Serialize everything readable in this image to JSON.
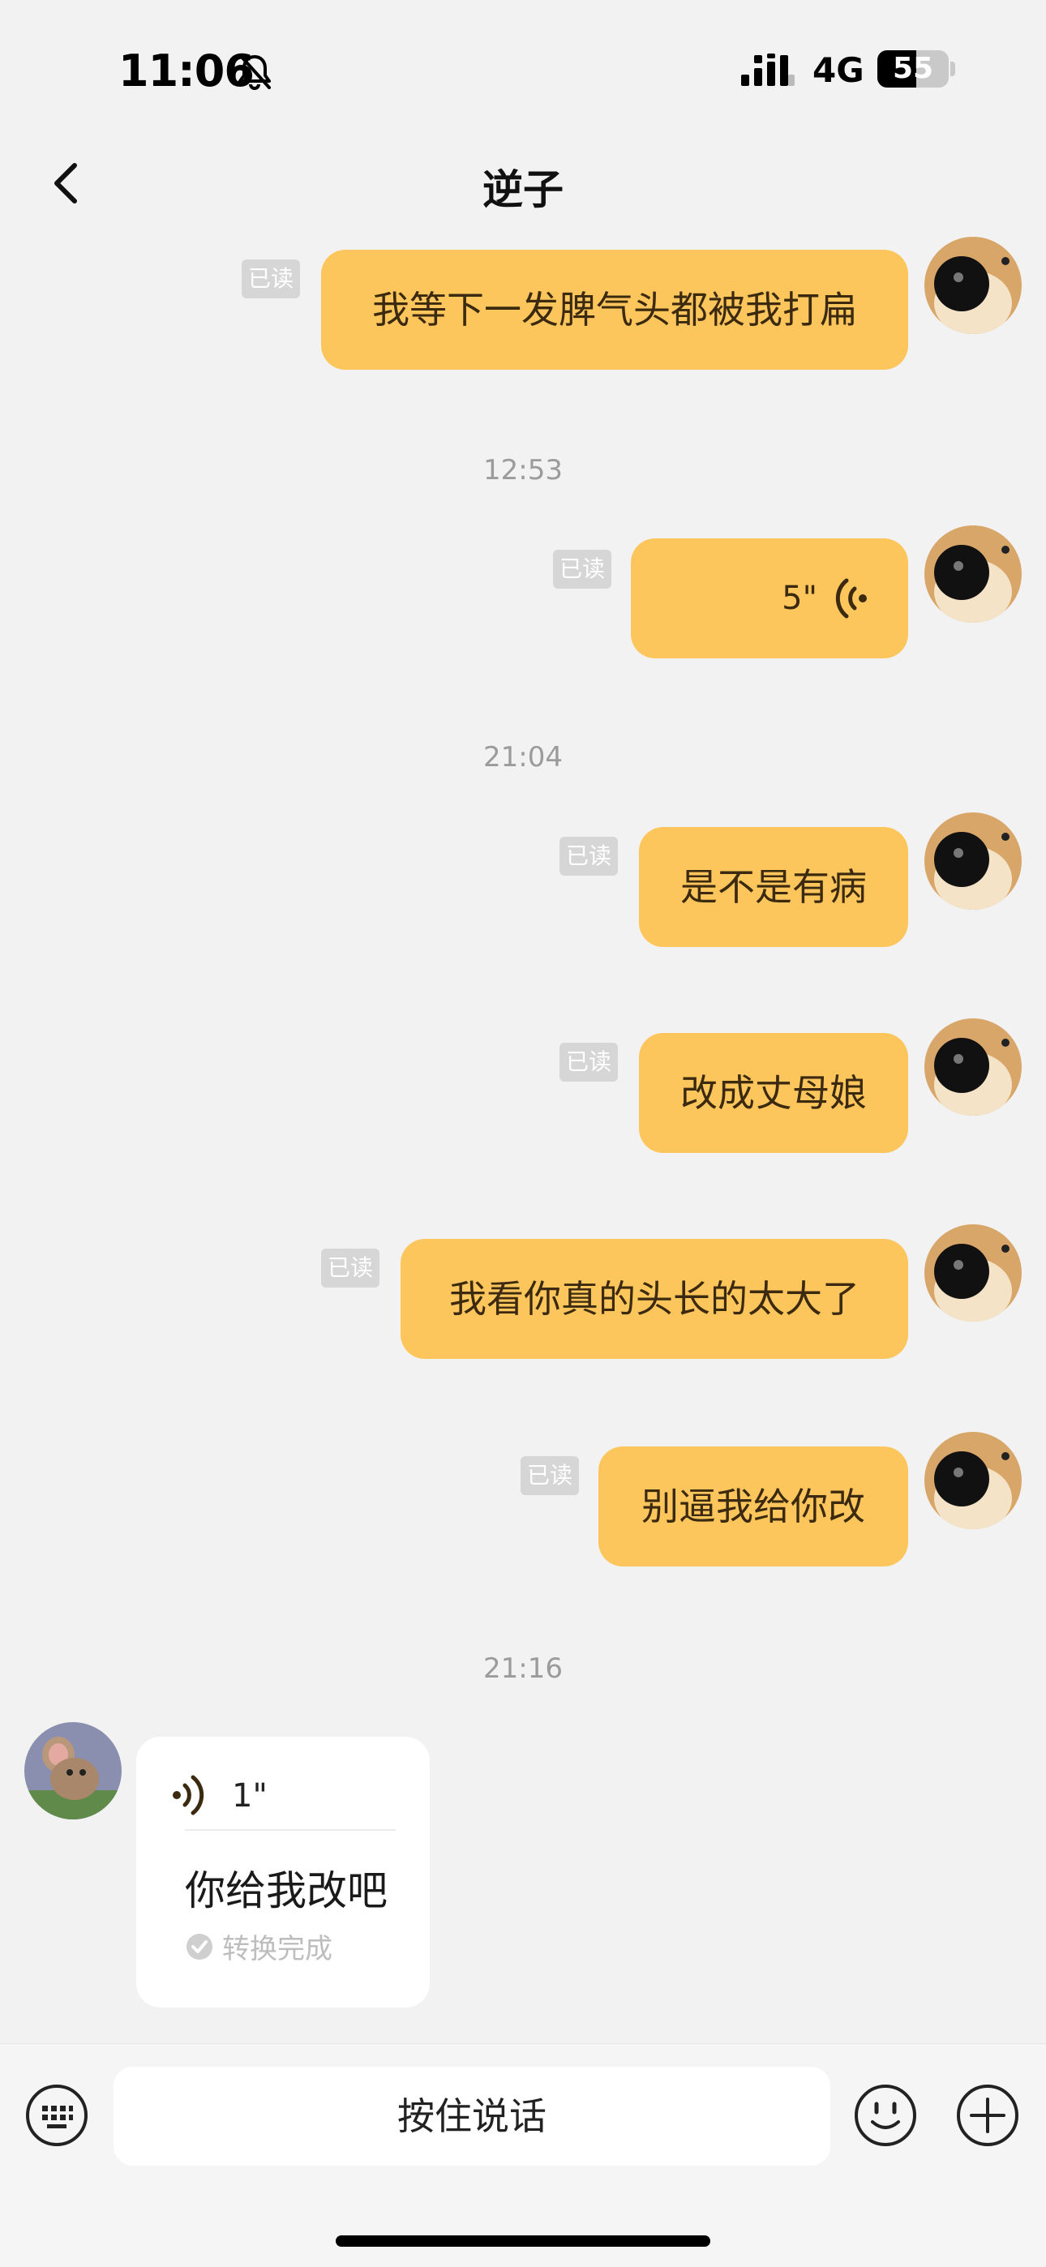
{
  "status_bar": {
    "time": "11:06",
    "network": "4G",
    "battery": "55",
    "battery_level": 0.55
  },
  "nav": {
    "title": "逆子"
  },
  "read_label": "已读",
  "timestamps": [
    "12:53",
    "21:04",
    "21:16"
  ],
  "outgoing": [
    {
      "text": "我等下一发脾气头都被我打扁"
    },
    {
      "voice_duration": "5\""
    },
    {
      "text": "是不是有病"
    },
    {
      "text": "改成丈母娘"
    },
    {
      "text": "我看你真的头长的太大了"
    },
    {
      "text": "别逼我给你改"
    }
  ],
  "incoming": {
    "voice_duration": "1\"",
    "transcript": "你给我改吧",
    "status": "转换完成"
  },
  "input_bar": {
    "hold_to_talk": "按住说话"
  }
}
